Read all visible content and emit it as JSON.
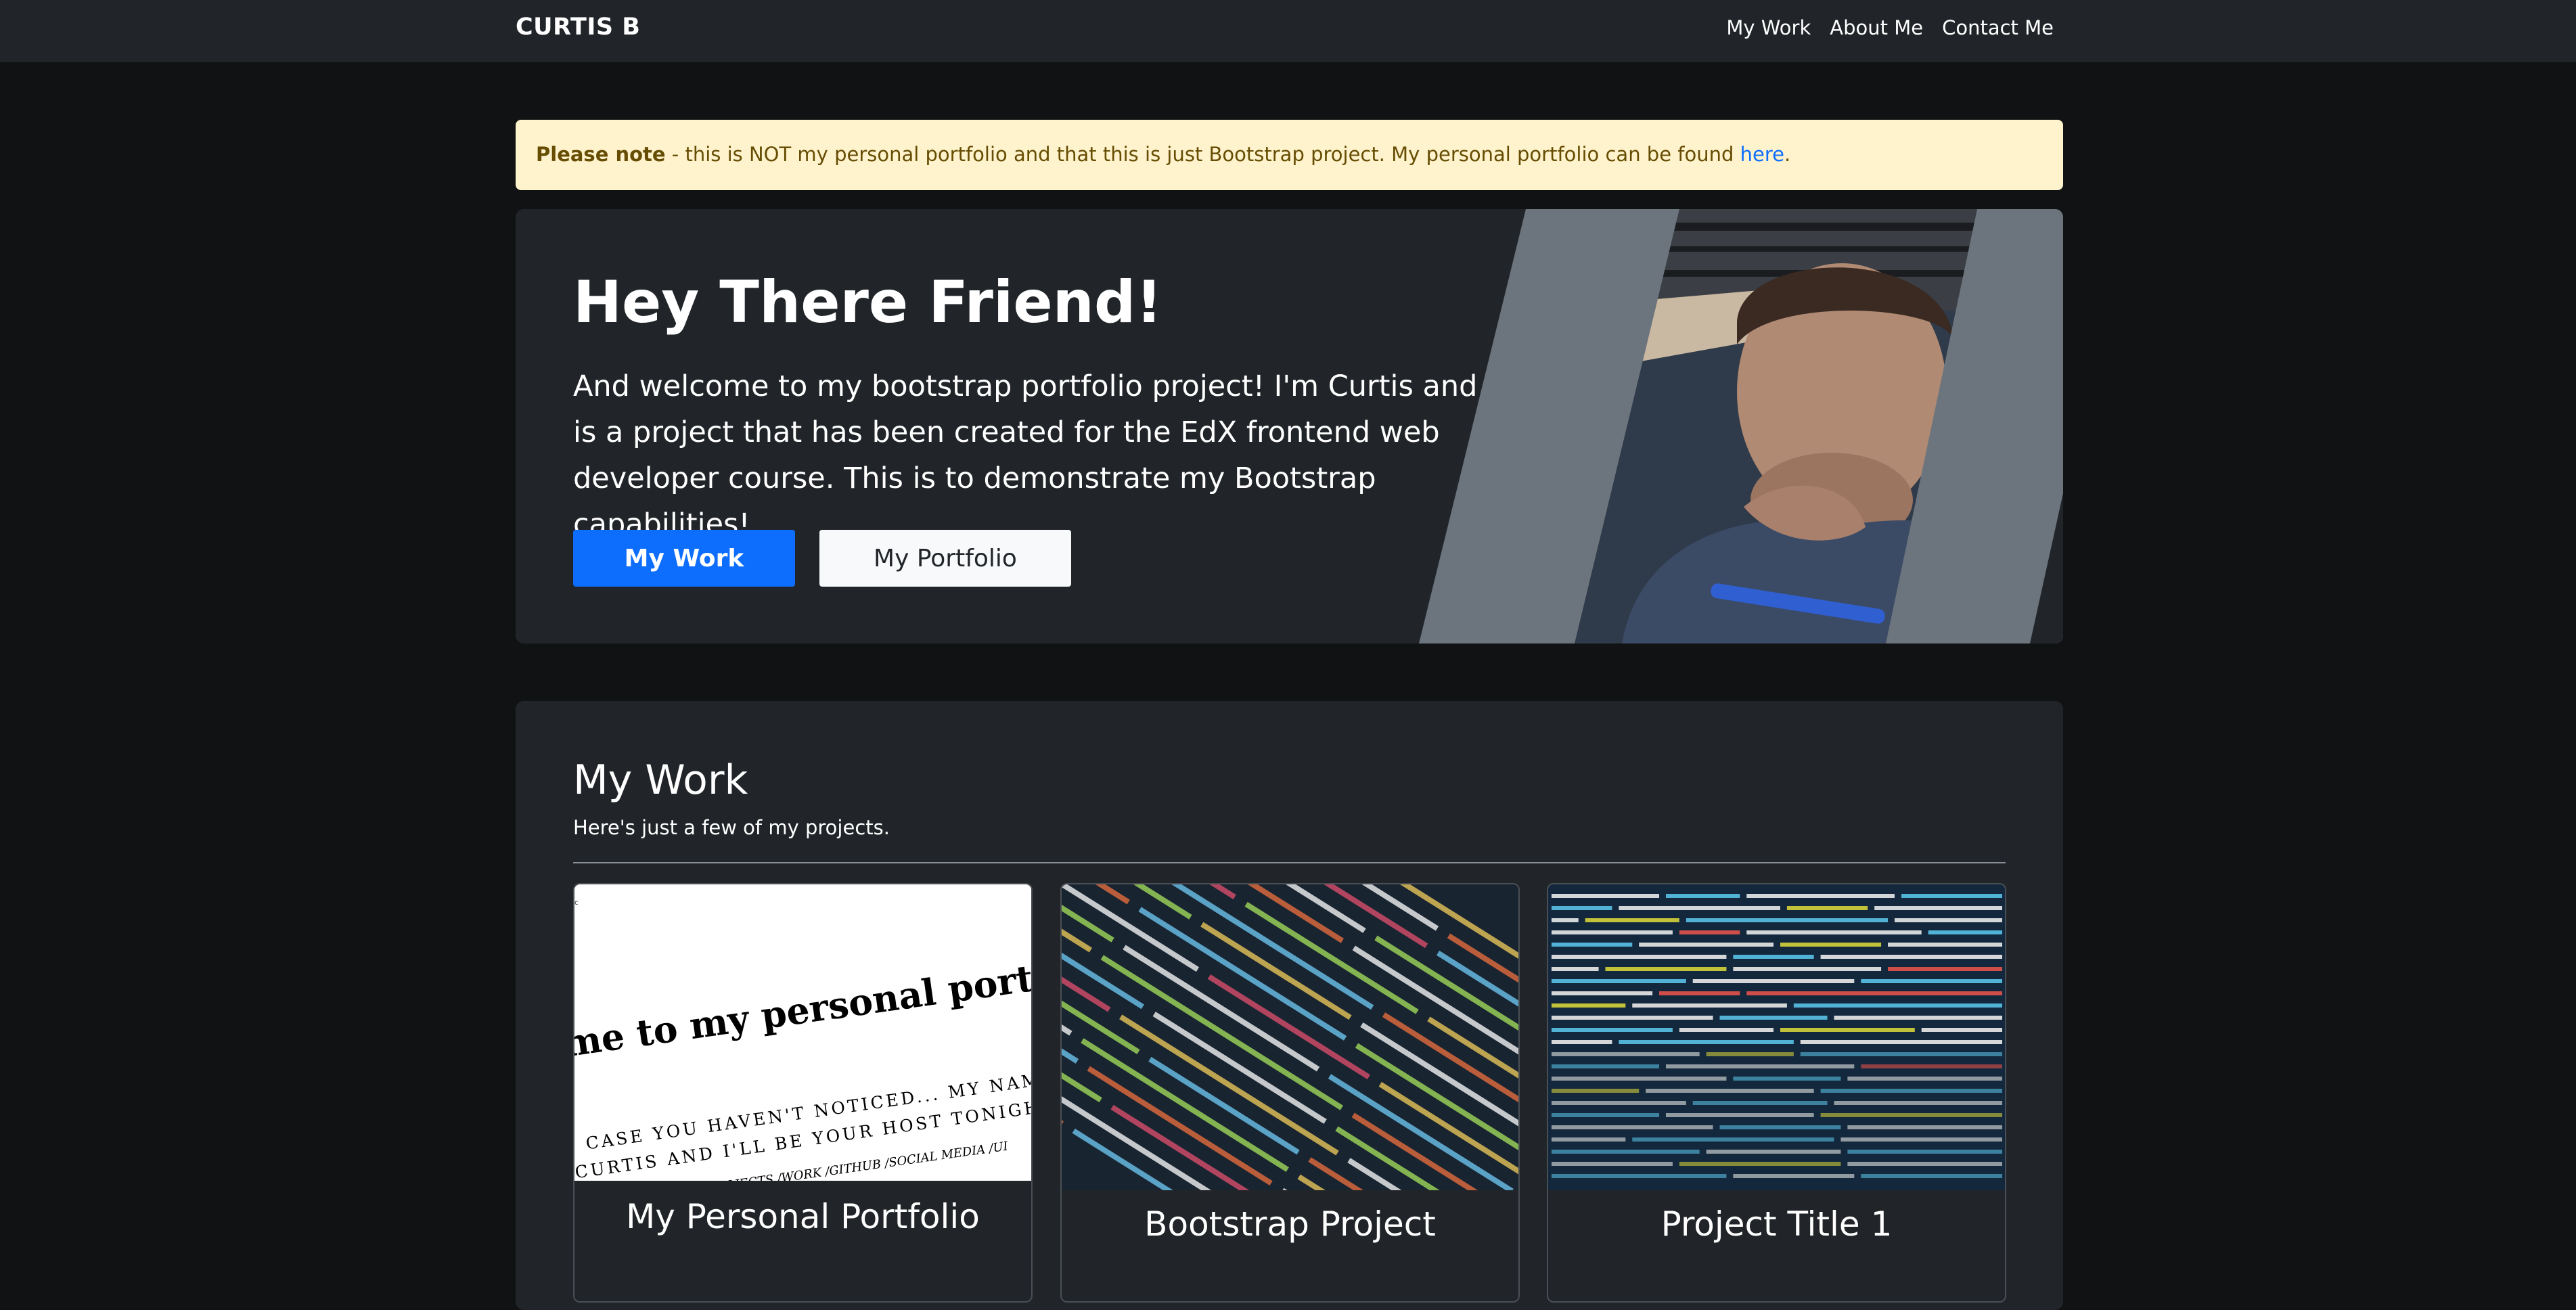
{
  "navbar": {
    "brand": "CURTIS B",
    "links": [
      "My Work",
      "About Me",
      "Contact Me"
    ]
  },
  "alert": {
    "bold": "Please note",
    "text": " - this is NOT my personal portfolio and that this is just Bootstrap project. My personal portfolio can be found ",
    "link": "here",
    "end": "."
  },
  "hero": {
    "title": "Hey There Friend!",
    "lead": "And welcome to my bootstrap portfolio project! I'm Curtis and this is a project that has been created for the EdX frontend web developer course. This is to demonstrate my Bootstrap capabilities!",
    "primary_button": "My Work",
    "secondary_button": "My Portfolio"
  },
  "work": {
    "title": "My Work",
    "subtitle": "Here's just a few of my projects.",
    "cards": [
      {
        "title": "My Personal Portfolio",
        "image_heading": "Welcome to my personal portfolio...",
        "image_line1": "IN CASE YOU HAVEN'T NOTICED... MY NAME IS",
        "image_line2": "CURTIS AND I'LL BE YOUR HOST TONIGHT!",
        "image_line3": "PROJECTS /WORK /GITHUB /SOCIAL MEDIA /UI"
      },
      {
        "title": "Bootstrap Project"
      },
      {
        "title": "Project Title 1"
      }
    ]
  },
  "colors": {
    "page_bg": "#111213",
    "panel_bg": "#212529",
    "primary": "#0d6efd",
    "alert_bg": "#fff3cd",
    "alert_text": "#664d03"
  }
}
